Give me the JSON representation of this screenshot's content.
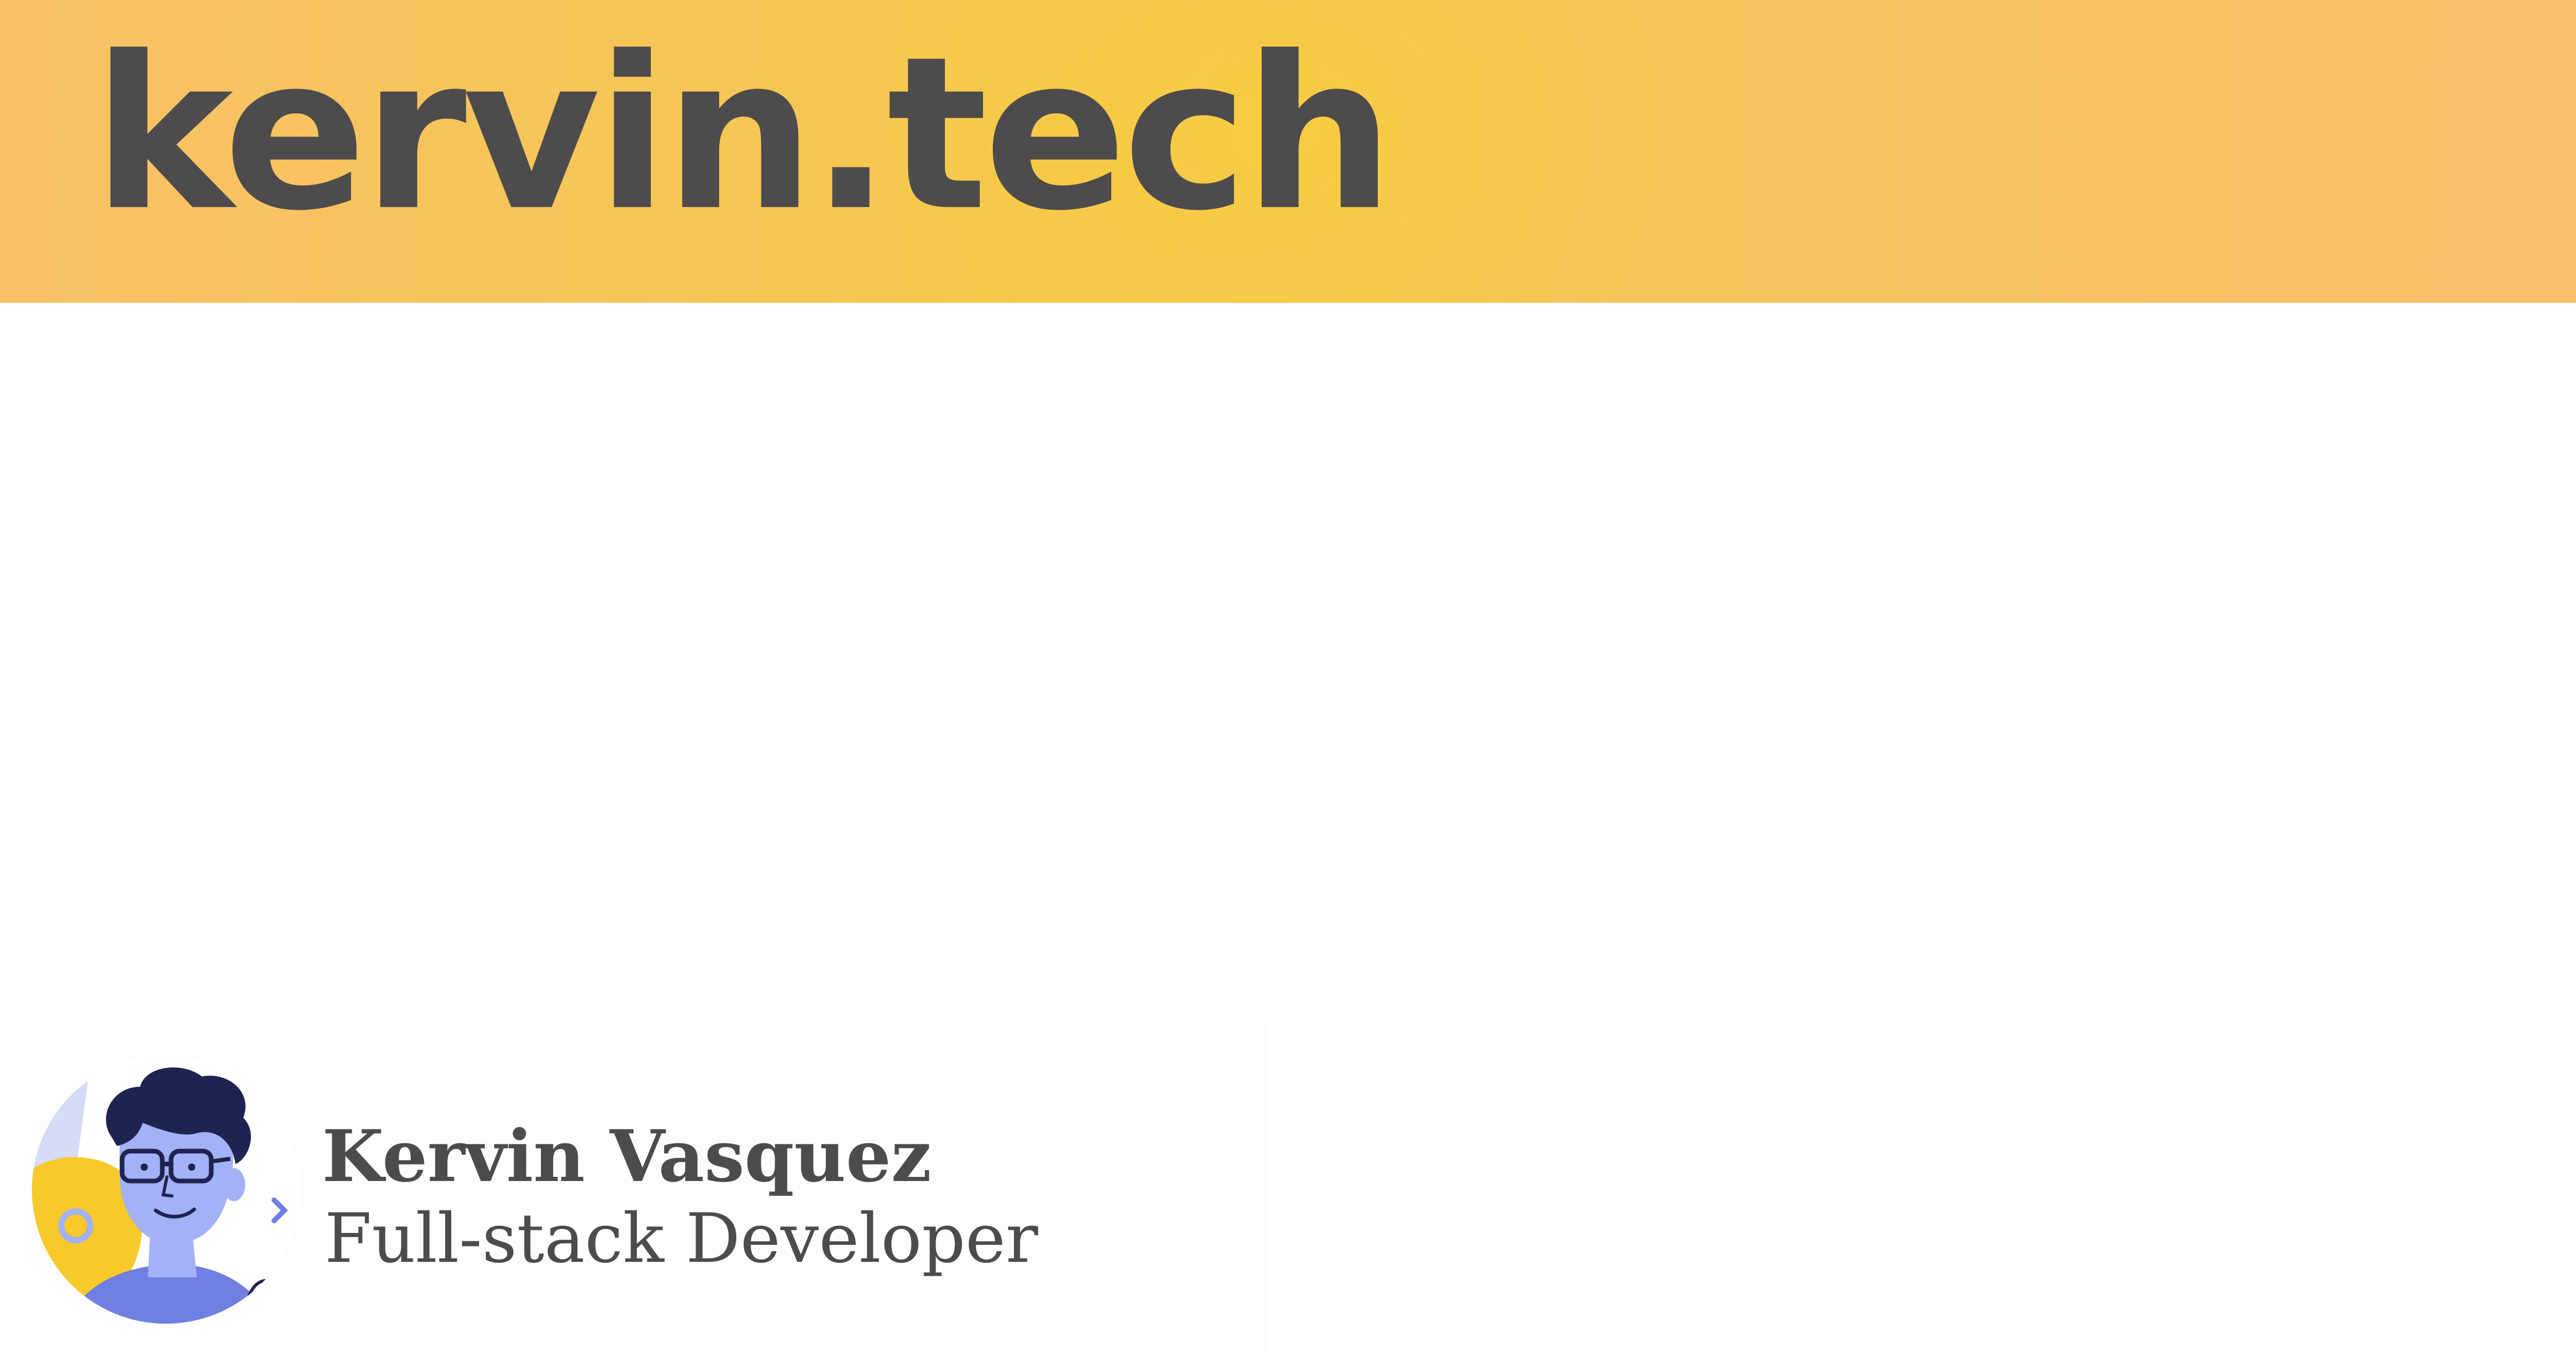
{
  "banner": {
    "title": "kervin.tech"
  },
  "author": {
    "name": "Kervin Vasquez",
    "role": "Full-stack Developer",
    "avatar_icon": "developer-avatar-icon"
  },
  "colors": {
    "banner_yellow": "#f6c84c",
    "banner_orange": "#f8c168",
    "text_dark": "#4d4b4b",
    "avatar_blue": "#a3b1f7",
    "avatar_dark": "#1f2350",
    "avatar_yellow": "#f7c92b"
  }
}
